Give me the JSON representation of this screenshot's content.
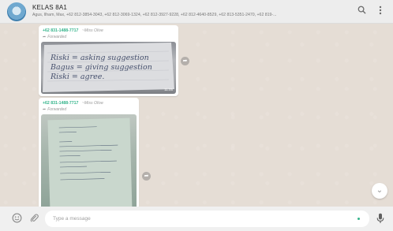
{
  "header": {
    "group_name": "KELAS 8A1",
    "members": "Agus, Ilham, Max, +62 812-3854-3043, +62 812-3069-1324, +62 812-3927-9228, +62 812-4640-8529, +62 813-5351-2470, +62 819-...",
    "search_icon": "search-icon",
    "menu_icon": "kebab-menu-icon"
  },
  "messages": [
    {
      "sender_phone": "+62 831-1488-7717",
      "sender_name": "~Miss Olive",
      "forwarded_label": "Forwarded",
      "photo_text_lines": [
        "Riski = asking suggestion",
        "Bagus = giving suggestion",
        "Riski = agree."
      ],
      "time": "11:05"
    },
    {
      "sender_phone": "+62 831-1488-7717",
      "sender_name": "~Miss Olive",
      "forwarded_label": "Forwarded"
    }
  ],
  "composer": {
    "placeholder": "Type a message",
    "emoji_icon": "emoji-icon",
    "attach_icon": "paperclip-icon",
    "mic_icon": "microphone-icon"
  },
  "colors": {
    "header_bg": "#ededed",
    "chat_bg": "#e5ddd5",
    "sender_green": "#35b48b"
  }
}
